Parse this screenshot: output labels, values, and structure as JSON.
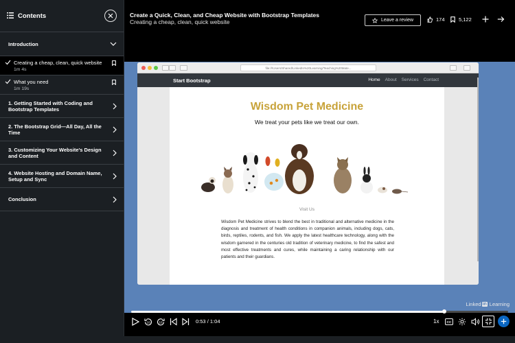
{
  "sidebar": {
    "title": "Contents",
    "sections": [
      {
        "label": "Introduction",
        "expanded": true,
        "items": [
          {
            "title": "Creating a cheap, clean, quick website",
            "duration": "1m 4s",
            "active": true
          },
          {
            "title": "What you need",
            "duration": "1m 19s",
            "active": false
          }
        ]
      },
      {
        "label": "1. Getting Started with Coding and Bootstrap Templates"
      },
      {
        "label": "2. The Bootstrap Grid—All Day, All the Time"
      },
      {
        "label": "3. Customizing Your Website's Design and Content"
      },
      {
        "label": "4. Website Hosting and Domain Name, Setup and Sync"
      },
      {
        "label": "Conclusion"
      }
    ]
  },
  "header": {
    "course_title": "Create a Quick, Clean, and Cheap Website with Bootstrap Templates",
    "video_title": "Creating a cheap, clean, quick website",
    "review_label": "Leave a review",
    "likes": "174",
    "saves": "5,122"
  },
  "video": {
    "browser_url": "file:///Users/Shared/LinkedIn%20Learning/Teaching%20Mate...",
    "site": {
      "brand": "Start Bootstrap",
      "nav": [
        "Home",
        "About",
        "Services",
        "Contact"
      ],
      "heading": "Wisdom Pet Medicine",
      "tagline": "We treat your pets like we treat our own.",
      "visit_label": "Visit Us",
      "paragraph": "Wisdom Pet Medicine strives to blend the best in traditional and alternative medicine in the diagnosis and treatment of health conditions in companion animals, including dogs, cats, birds, reptiles, rodents, and fish. We apply the latest healthcare technology, along with the wisdom garnered in the centuries old tradition of veterinary medicine, to find the safest and most effective treatments and cures, while maintaining a caring relationship with our patients and their guardians."
    },
    "watermark_left": "Linked",
    "watermark_in": "in",
    "watermark_right": "Learning"
  },
  "player": {
    "current_time": "0:53",
    "separator": "/",
    "duration": "1:04",
    "progress_fraction": 0.83,
    "speed": "1x"
  },
  "colors": {
    "accent": "#0a66c2",
    "heading_gold": "#c8a33a",
    "video_bg": "#5a82b8"
  }
}
